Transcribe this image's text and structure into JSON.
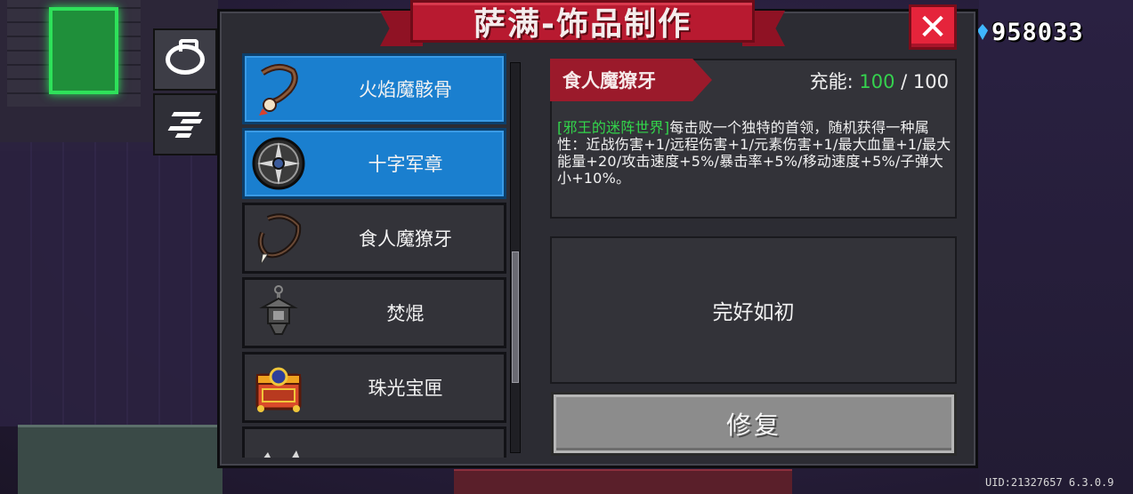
{
  "currency": {
    "value": "958033",
    "icon": "blue-gem-icon"
  },
  "panel": {
    "title": "萨满-饰品制作",
    "close_label": "✕"
  },
  "side_tabs": [
    {
      "name": "accessory-tab",
      "icon": "ring-icon",
      "active": true
    },
    {
      "name": "feather-tab",
      "icon": "feather-lines-icon",
      "active": false
    }
  ],
  "list": {
    "items": [
      {
        "label": "火焰魔骸骨",
        "icon": "bone-necklace-icon",
        "selected": true
      },
      {
        "label": "十字军章",
        "icon": "crusader-shield-icon",
        "selected": true
      },
      {
        "label": "食人魔獠牙",
        "icon": "fang-necklace-icon",
        "selected": false
      },
      {
        "label": "焚焜",
        "icon": "lantern-icon",
        "selected": false
      },
      {
        "label": "珠光宝匣",
        "icon": "jewel-box-icon",
        "selected": false
      },
      {
        "label": "",
        "icon": "partial-item-icon",
        "selected": false
      }
    ],
    "scroll_position": 0.48
  },
  "detail": {
    "name": "食人魔獠牙",
    "charge_label": "充能: ",
    "charge_current": "100",
    "charge_sep": " / ",
    "charge_max": "100",
    "desc_tag": "[邪王的迷阵世界]",
    "desc_text": "每击败一个独特的首领，随机获得一种属性：近战伤害+1/远程伤害+1/元素伤害+1/最大血量+1/最大能量+20/攻击速度+5%/暴击率+5%/移动速度+5%/子弹大小+10%。",
    "status": "完好如初",
    "repair_label": "修复"
  },
  "footer": {
    "uid": "UID:21327657 6.3.0.9"
  },
  "colors": {
    "accent_blue": "#1a7fcf",
    "banner_red": "#b81a30",
    "close_red": "#e5243b",
    "highlight_green": "#35d14e"
  }
}
